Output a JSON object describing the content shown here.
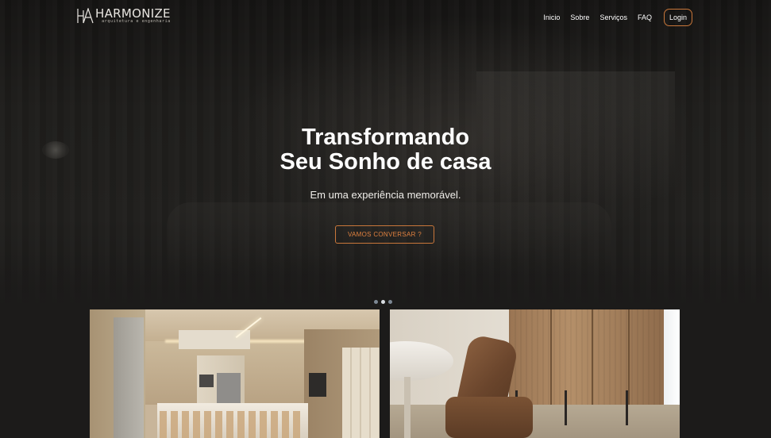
{
  "brand": {
    "name": "HARMONIZE",
    "tagline": "arquitetura e engenharia",
    "logo_icon": "ha-monogram-icon"
  },
  "nav": {
    "items": [
      {
        "label": "Inicio"
      },
      {
        "label": "Sobre"
      },
      {
        "label": "Serviços"
      },
      {
        "label": "FAQ"
      }
    ],
    "login_label": "Login"
  },
  "hero": {
    "title_line1": "Transformando",
    "title_line2": "Seu Sonho de casa",
    "subtitle": "Em uma experiência memorável.",
    "cta_label": "VAMOS CONVERSAR ?"
  },
  "carousel": {
    "dot_count": 3,
    "active_index": 1
  },
  "gallery": {
    "images": [
      {
        "subject": "kitchen-interior-image"
      },
      {
        "subject": "chair-wardrobe-interior-image"
      }
    ]
  },
  "colors": {
    "accent": "#c9773a",
    "cta_text": "#e0813f",
    "background": "#1c1b1a",
    "text": "#ffffff"
  }
}
